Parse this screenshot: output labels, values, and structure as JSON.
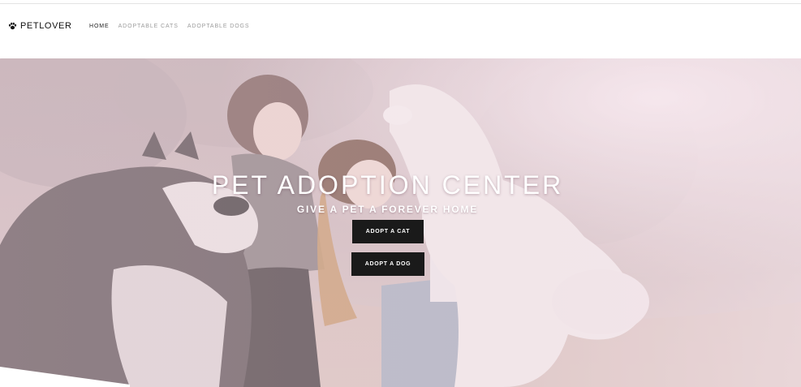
{
  "brand": {
    "name": "PETLOVER",
    "icon": "paw-icon"
  },
  "nav": {
    "items": [
      {
        "label": "HOME",
        "active": true
      },
      {
        "label": "ADOPTABLE CATS",
        "active": false
      },
      {
        "label": "ADOPTABLE DOGS",
        "active": false
      }
    ]
  },
  "hero": {
    "title": "PET ADOPTION CENTER",
    "subtitle": "GIVE A PET A FOREVER HOME",
    "buttons": {
      "cat": "ADOPT A CAT",
      "dog": "ADOPT A DOG"
    },
    "overlay_color": "#f3dfe6"
  },
  "colors": {
    "button_bg": "#1a1a1a",
    "nav_active": "#222222",
    "nav_inactive": "#9c9c9c"
  }
}
